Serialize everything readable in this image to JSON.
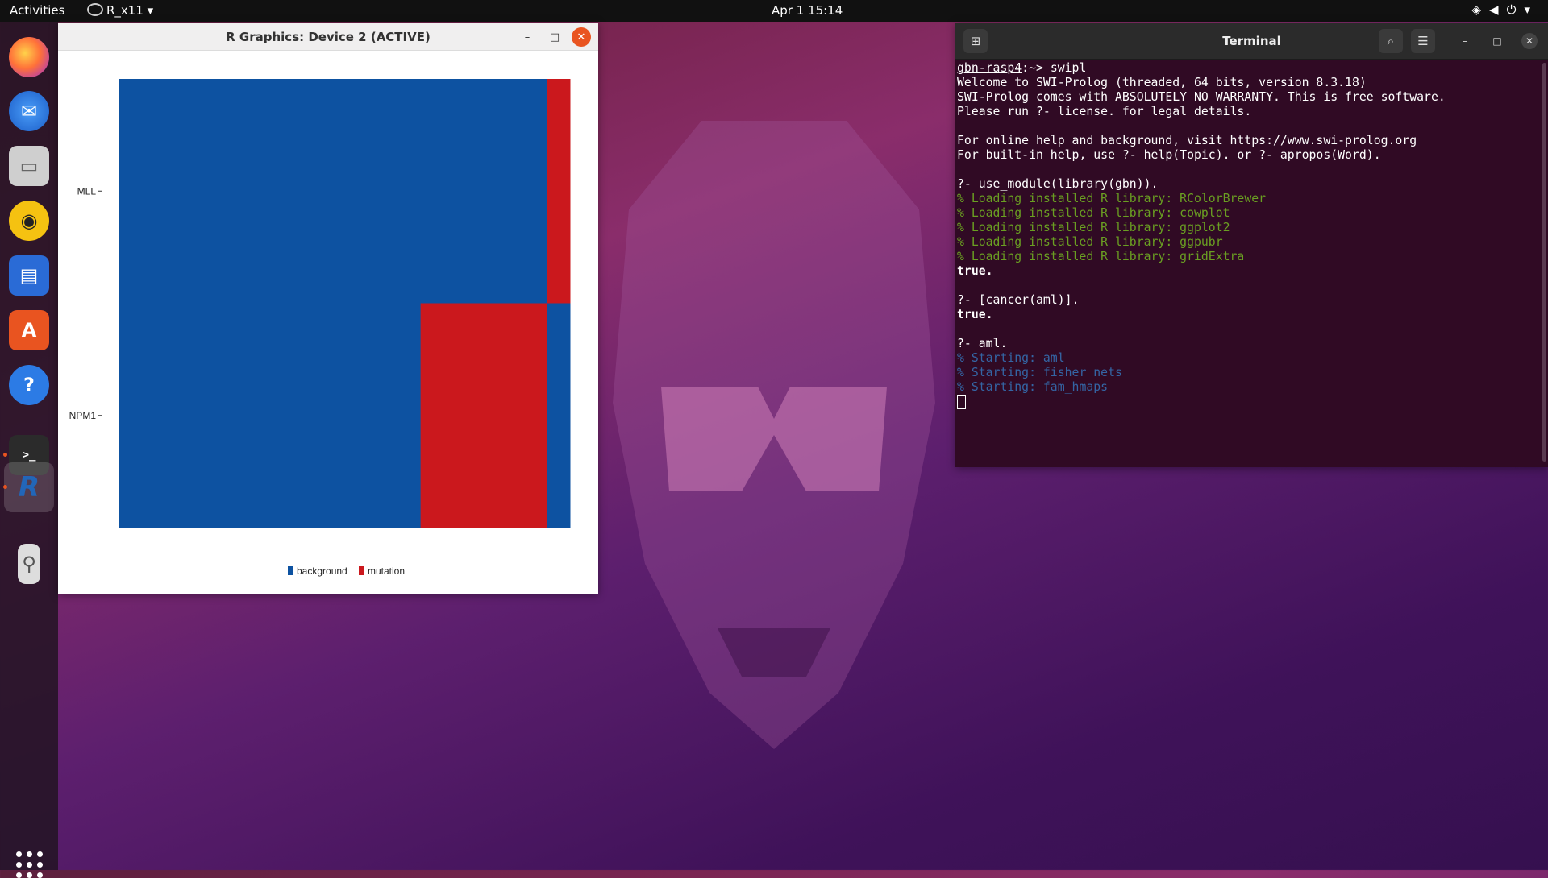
{
  "topbar": {
    "activities": "Activities",
    "app_menu": "R_x11",
    "clock": "Apr 1  15:14",
    "tray": "wifi volume power"
  },
  "dock": {
    "items": [
      "firefox-icon",
      "thunderbird-icon",
      "files-icon",
      "rhythmbox-icon",
      "writer-icon",
      "software-icon",
      "help-icon",
      "terminal-icon",
      "r-icon",
      "usb-icon"
    ],
    "colors": {
      "accent": "#e95420"
    }
  },
  "r_window": {
    "title": "R Graphics: Device 2 (ACTIVE)"
  },
  "chart_data": {
    "type": "heatmap",
    "rows": [
      "MLL",
      "NPM1"
    ],
    "legend": [
      "background",
      "mutation"
    ],
    "colors": {
      "background": "#0d52a1",
      "mutation": "#cb181d"
    },
    "cells": [
      {
        "row": "MLL",
        "segments": [
          {
            "value": "background",
            "fraction": 0.949
          },
          {
            "value": "mutation",
            "fraction": 0.051
          }
        ]
      },
      {
        "row": "NPM1",
        "segments": [
          {
            "value": "background",
            "fraction": 0.669
          },
          {
            "value": "mutation",
            "fraction": 0.28
          },
          {
            "value": "background",
            "fraction": 0.051
          }
        ]
      }
    ]
  },
  "terminal": {
    "title": "Terminal",
    "lines": [
      [
        {
          "t": "gbn-rasp4",
          "c": "under"
        },
        {
          "t": ":~> swipl",
          "c": ""
        }
      ],
      [
        {
          "t": "Welcome to SWI-Prolog (threaded, 64 bits, version 8.3.18)",
          "c": ""
        }
      ],
      [
        {
          "t": "SWI-Prolog comes with ABSOLUTELY NO WARRANTY. This is free software.",
          "c": ""
        }
      ],
      [
        {
          "t": "Please run ?- license. for legal details.",
          "c": ""
        }
      ],
      [
        {
          "t": "",
          "c": ""
        }
      ],
      [
        {
          "t": "For online help and background, visit https://www.swi-prolog.org",
          "c": ""
        }
      ],
      [
        {
          "t": "For built-in help, use ?- help(Topic). or ?- apropos(Word).",
          "c": ""
        }
      ],
      [
        {
          "t": "",
          "c": ""
        }
      ],
      [
        {
          "t": "?- use_module(library(gbn)).",
          "c": ""
        }
      ],
      [
        {
          "t": "% Loading installed R library: RColorBrewer",
          "c": "g2"
        }
      ],
      [
        {
          "t": "% Loading installed R library: cowplot",
          "c": "g2"
        }
      ],
      [
        {
          "t": "% Loading installed R library: ggplot2",
          "c": "g2"
        }
      ],
      [
        {
          "t": "% Loading installed R library: ggpubr",
          "c": "g2"
        }
      ],
      [
        {
          "t": "% Loading installed R library: gridExtra",
          "c": "g2"
        }
      ],
      [
        {
          "t": "true.",
          "c": "bold"
        }
      ],
      [
        {
          "t": "",
          "c": ""
        }
      ],
      [
        {
          "t": "?- [cancer(aml)].",
          "c": ""
        }
      ],
      [
        {
          "t": "true.",
          "c": "bold"
        }
      ],
      [
        {
          "t": "",
          "c": ""
        }
      ],
      [
        {
          "t": "?- aml.",
          "c": ""
        }
      ],
      [
        {
          "t": "% Starting: aml",
          "c": "b"
        }
      ],
      [
        {
          "t": "% Starting: fisher_nets",
          "c": "b"
        }
      ],
      [
        {
          "t": "% Starting: fam_hmaps",
          "c": "b"
        }
      ]
    ]
  }
}
